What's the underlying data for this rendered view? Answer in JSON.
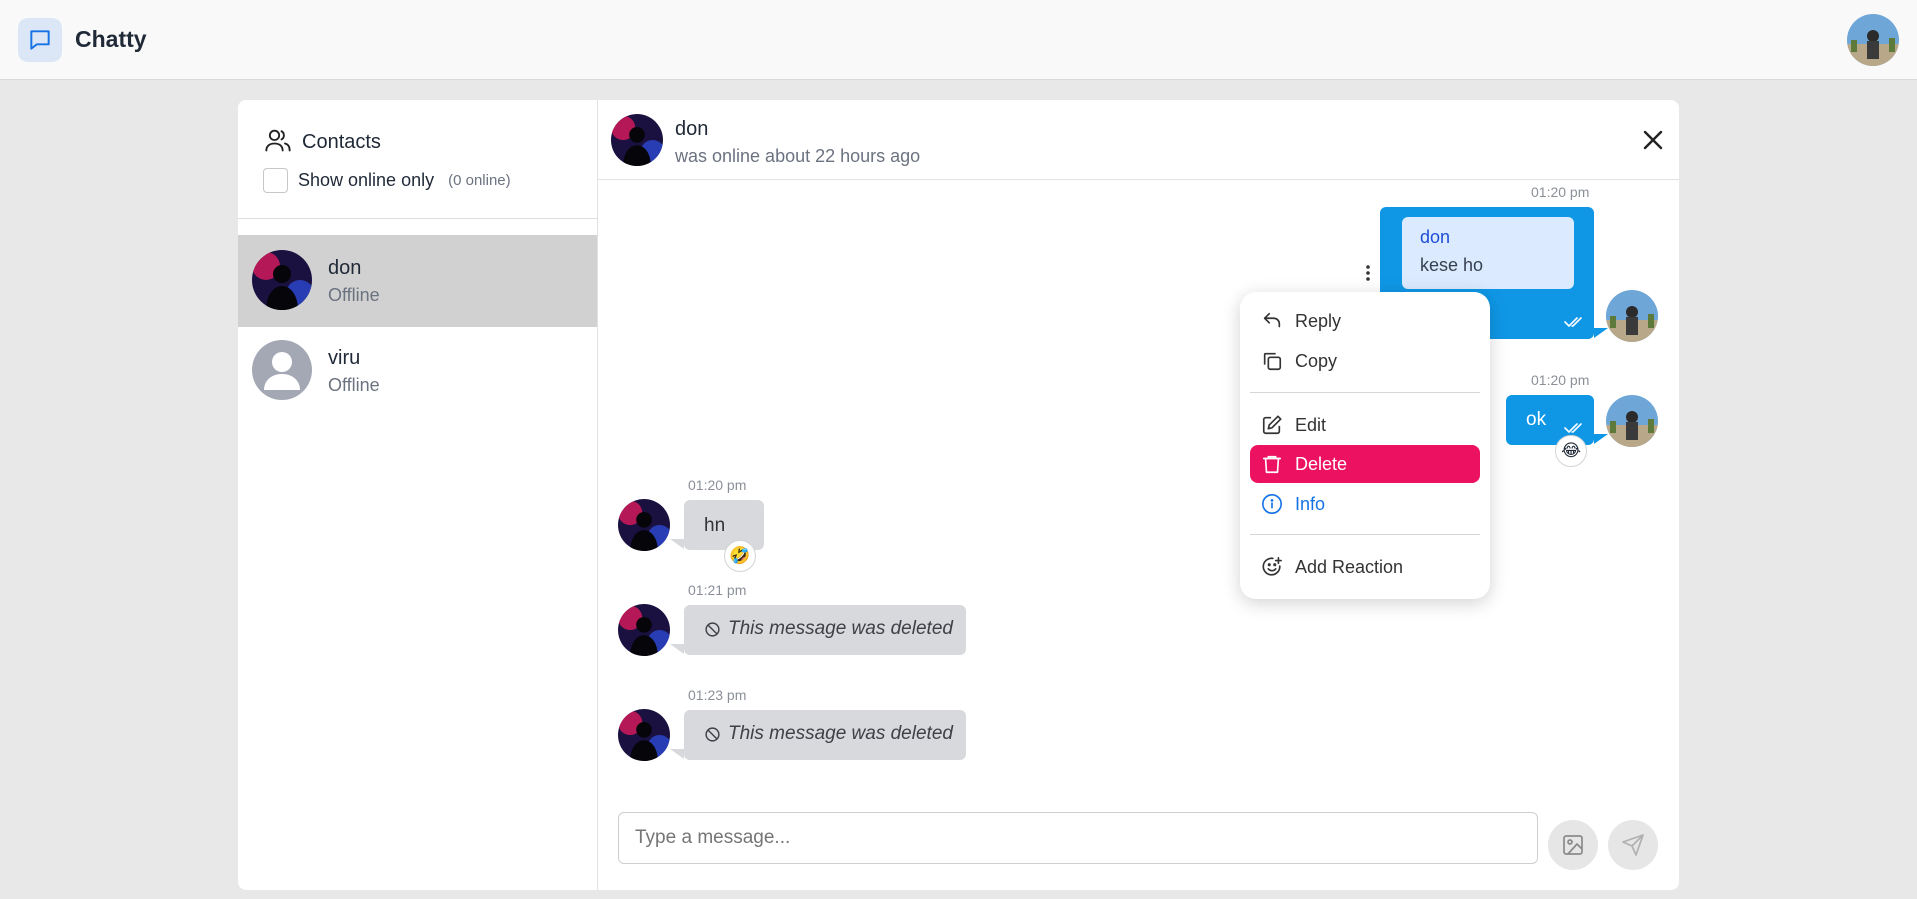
{
  "app": {
    "title": "Chatty"
  },
  "sidebar": {
    "title": "Contacts",
    "online_filter": {
      "label": "Show online only",
      "count_text": "(0 online)"
    },
    "contacts": [
      {
        "name": "don",
        "status": "Offline",
        "active": true
      },
      {
        "name": "viru",
        "status": "Offline",
        "active": false
      }
    ]
  },
  "chat": {
    "header": {
      "name": "don",
      "subtitle": "was online about 22 hours ago"
    },
    "messages": [
      {
        "direction": "out",
        "time": "01:20 pm",
        "reply_to": {
          "name": "don",
          "text": "kese ho"
        },
        "text": ""
      },
      {
        "direction": "out",
        "time": "01:20 pm",
        "text": "ok",
        "reaction": "😂"
      },
      {
        "direction": "in",
        "time": "01:20 pm",
        "text": "hn",
        "reaction": "🤣"
      },
      {
        "direction": "in",
        "time": "01:21 pm",
        "text": "This message was deleted",
        "deleted": true
      },
      {
        "direction": "in",
        "time": "01:23 pm",
        "text": "This message was deleted",
        "deleted": true
      }
    ],
    "context_menu": {
      "items": [
        {
          "label": "Reply",
          "icon": "reply-icon"
        },
        {
          "label": "Copy",
          "icon": "copy-icon"
        },
        {
          "label": "Edit",
          "icon": "edit-icon"
        },
        {
          "label": "Delete",
          "icon": "trash-icon"
        },
        {
          "label": "Info",
          "icon": "info-icon"
        },
        {
          "label": "Add Reaction",
          "icon": "smiley-plus-icon"
        }
      ]
    },
    "composer": {
      "placeholder": "Type a message..."
    }
  },
  "colors": {
    "accent": "#0f97e6",
    "danger": "#ec1161",
    "bubble_in": "#d7d9dd",
    "quote_bg": "#dbeafe"
  }
}
